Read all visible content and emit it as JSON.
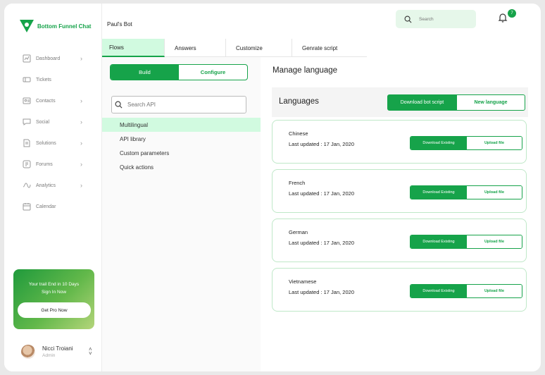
{
  "brand": {
    "name": "Bottom Funnel Chat",
    "accent": "#16a34a"
  },
  "sidebar": {
    "items": [
      {
        "label": "Dashboard",
        "icon": "chart-icon",
        "chevron": true
      },
      {
        "label": "Tickets",
        "icon": "ticket-icon",
        "chevron": false
      },
      {
        "label": "Contacts",
        "icon": "contacts-icon",
        "chevron": true
      },
      {
        "label": "Social",
        "icon": "chat-icon",
        "chevron": true
      },
      {
        "label": "Solutions",
        "icon": "document-icon",
        "chevron": true
      },
      {
        "label": "Forums",
        "icon": "forum-icon",
        "chevron": true
      },
      {
        "label": "Analytics",
        "icon": "analytics-icon",
        "chevron": true
      },
      {
        "label": "Calendar",
        "icon": "calendar-icon",
        "chevron": false
      }
    ],
    "promo": {
      "line1": "Your trail End in 10 Days",
      "line2": "Sign In Now",
      "button": "Get Pro Now"
    },
    "user": {
      "name": "Nicci Troiani",
      "role": "Admin"
    }
  },
  "header": {
    "bot_name": "Paul's Bot",
    "search_placeholder": "Search",
    "notification_count": "7"
  },
  "tabs": [
    "Flows",
    "Answers",
    "Customize",
    "Genrate script"
  ],
  "left_panel": {
    "build_label": "Build",
    "configure_label": "Configure",
    "search_placeholder": "Search API",
    "items": [
      "Multilingual",
      "API library",
      "Custom parameters",
      "Quick actions"
    ]
  },
  "main": {
    "title": "Manage language",
    "languages_title": "Languages",
    "download_script_label": "Download bot script",
    "new_language_label": "New language",
    "download_existing_label": "Download Existing",
    "upload_label": "Upload file",
    "languages": [
      {
        "name": "Chinese",
        "updated": "Last updated : 17 Jan, 2020"
      },
      {
        "name": "French",
        "updated": "Last updated : 17 Jan, 2020"
      },
      {
        "name": "German",
        "updated": "Last updated : 17 Jan, 2020"
      },
      {
        "name": "Vietnamese",
        "updated": "Last updated : 17 Jan, 2020"
      }
    ]
  }
}
